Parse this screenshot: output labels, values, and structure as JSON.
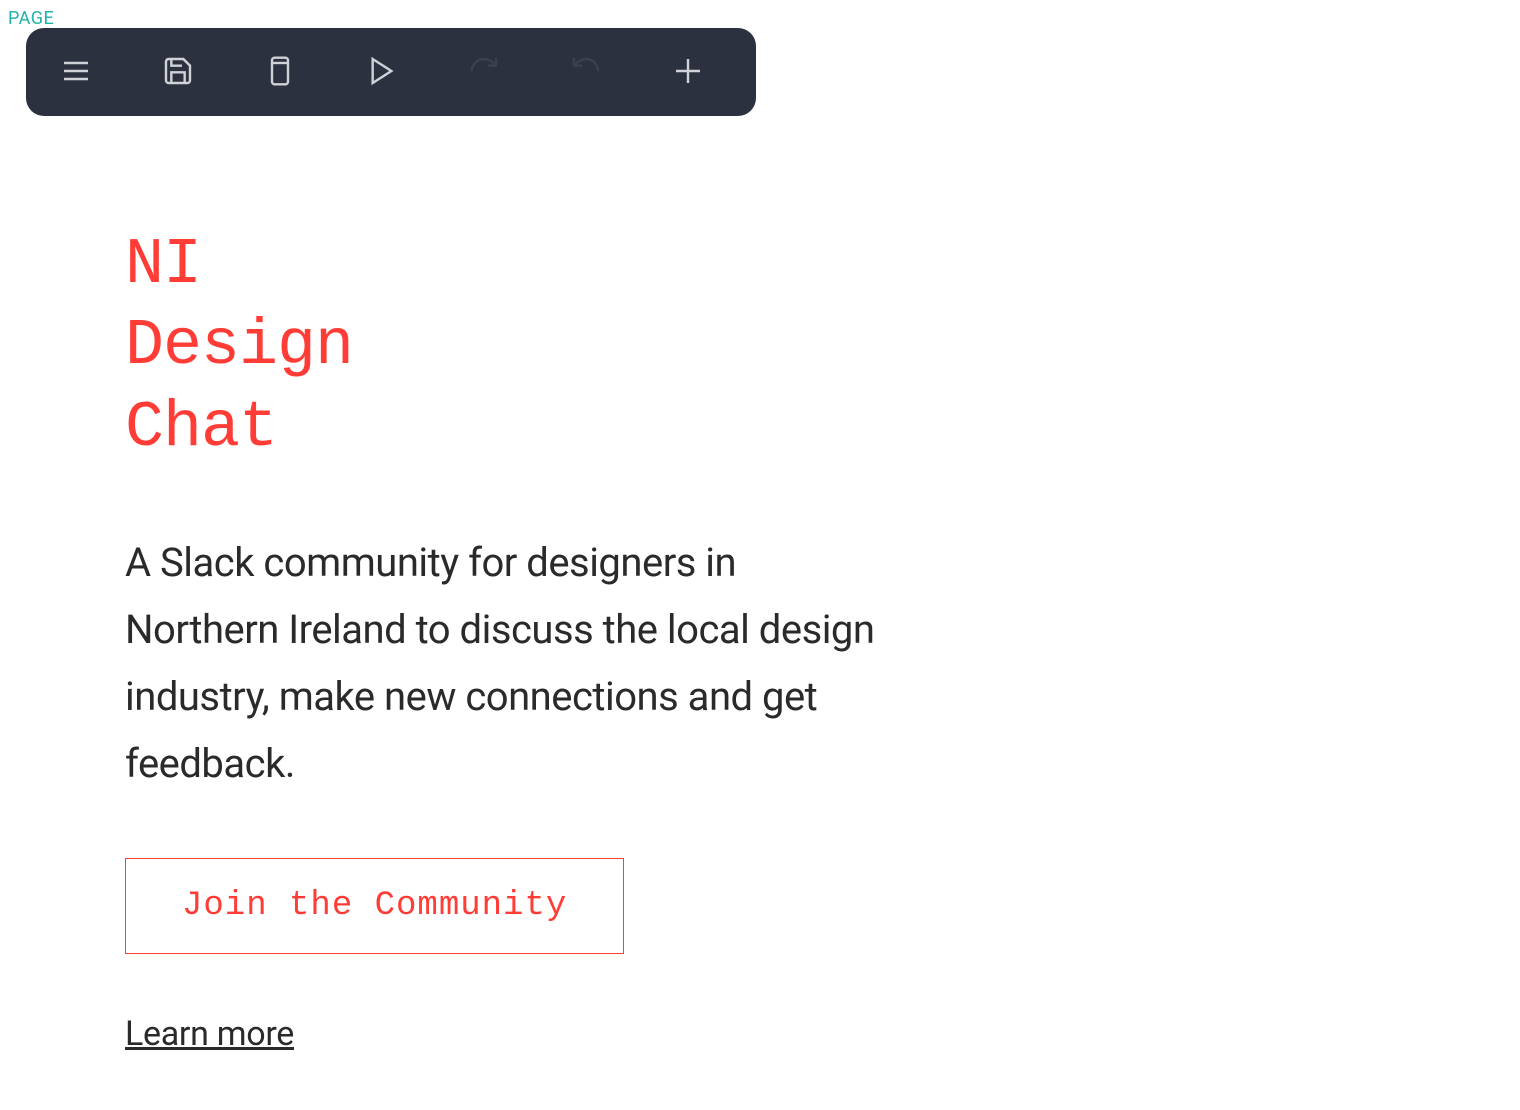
{
  "page_label": "PAGE",
  "toolbar": {
    "icons": [
      "menu",
      "save",
      "mobile",
      "play",
      "redo",
      "undo",
      "plus"
    ]
  },
  "content": {
    "heading_line1": "NI",
    "heading_line2": "Design",
    "heading_line3": "Chat",
    "description": "A Slack community for designers in Northern Ireland to discuss the local design industry, make new connections and get feedback.",
    "join_button_label": "Join the Community",
    "learn_more_label": "Learn more"
  },
  "colors": {
    "accent": "#ff3c36",
    "toolbar_bg": "#2c3140",
    "teal": "#20b2aa",
    "text": "#2a2a2a"
  }
}
